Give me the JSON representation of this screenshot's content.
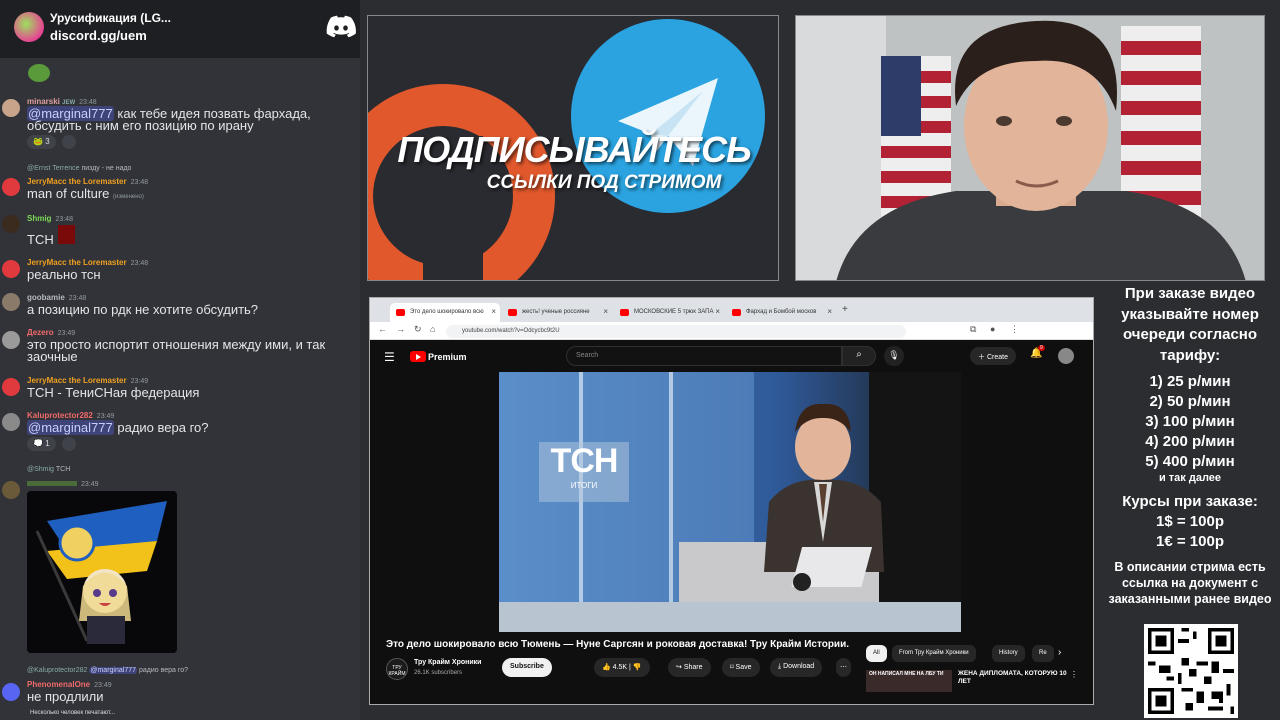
{
  "discord": {
    "server_name": "Урусификация (LG...",
    "invite": "discord.gg/uem",
    "messages": [
      {
        "user": "minarski",
        "badge": "JEW",
        "time": "23:48",
        "mention": "@marginal777",
        "text": " как тебе идея позвать фархада, обсудить с ним его позицию по ирану",
        "reaction_count": "3",
        "user_color": "#e0a0a0"
      },
      {
        "reply_to": "@Ernst Terrence",
        "reply_text": "пизду - не надо",
        "user": "JerryMacc the Loremaster",
        "time": "23:48",
        "text": "man of culture",
        "edited": "(изменено)",
        "user_color": "#f0a020"
      },
      {
        "user": "Shmig",
        "time": "23:48",
        "text": "ТСН",
        "user_color": "#7ed957"
      },
      {
        "user": "JerryMacc the Loremaster",
        "time": "23:48",
        "text": "реально тсн",
        "user_color": "#f0a020"
      },
      {
        "user": "goobamie",
        "time": "23:48",
        "text": "а позицию по рдк не хотите обсудить?",
        "user_color": "#b5bac1"
      },
      {
        "user": "Дezero",
        "time": "23:49",
        "text": "это просто испортит отношения между ими, и так заочные",
        "user_color": "#f06a6a"
      },
      {
        "user": "JerryMacc the Loremaster",
        "time": "23:49",
        "text": "ТСН - ТениСНая федерация",
        "user_color": "#f0a020"
      },
      {
        "user": "Kaluprotector282",
        "time": "23:49",
        "mention": "@marginal777",
        "text": " радио вера го?",
        "reaction_count": "1",
        "user_color": "#f06a6a"
      },
      {
        "reply_to": "@Shmig",
        "reply_text": "ТСН",
        "user": "",
        "time": "23:49",
        "text": "",
        "user_color": "#7ed957"
      },
      {
        "reply_to": "@Kaluprotector282",
        "reply_mention": "@marginal777",
        "reply_text": "радио вера го?",
        "user": "PhenomenalOne",
        "time": "23:49",
        "text": "не продлили",
        "user_color": "#f06a6a"
      }
    ],
    "typing": "Несколько человек печатают..."
  },
  "banner": {
    "title": "ПОДПИСЫВАЙТЕСЬ",
    "subtitle": "ССЫЛКИ ПОД СТРИМОМ"
  },
  "browser": {
    "tabs": [
      {
        "label": "Это дело шокировало всю"
      },
      {
        "label": "жесть! ученые россияне"
      },
      {
        "label": "МОСКОВСКИЕ 5 трюк ЗАПА"
      },
      {
        "label": "Фархад и Бомбой москов"
      }
    ],
    "new_tab": "+",
    "url": "youtube.com/watch?v=Odcycbc9t2U"
  },
  "youtube": {
    "premium_label": "Premium",
    "search_placeholder": "Search",
    "create_label": "Create",
    "notification_count": "9",
    "video_title": "Это дело шокировало всю Тюмень — Нуне Саргсян и роковая доставка! Тру Крайм Истории.",
    "channel_name": "Тру Крайм Хроники",
    "channel_avatar_text": "ТРУ КРАЙМ",
    "subscribers": "26.1K subscribers",
    "subscribe_label": "Subscribe",
    "likes": "4.5K",
    "share_label": "Share",
    "save_label": "Save",
    "download_label": "Download",
    "chips": [
      "All",
      "From Тру Крайм Хроники",
      "History",
      "Re"
    ],
    "rec_thumb_text": "ОН НАПИСАЛ МНЕ НА ЛБУ ТИ",
    "rec_title": "ЖЕНА ДИПЛОМАТА, КОТОРУЮ 10 ЛЕТ",
    "video_overlay": {
      "logo": "ТСН",
      "sub": "ИТОГИ"
    }
  },
  "pricing": {
    "intro": "При заказе видео указывайте номер очереди согласно тарифу:",
    "tiers": [
      "1) 25 р/мин",
      "2) 50 р/мин",
      "3) 100 р/мин",
      "4) 200 р/мин",
      "5) 400 р/мин"
    ],
    "etc": "и так далее",
    "rates_title": "Курсы при заказе:",
    "rates": [
      "1$ = 100р",
      "1€ = 100р"
    ],
    "description": "В описании стрима есть ссылка на документ с заказанными ранее видео"
  },
  "colors": {
    "discord_bg": "#313338",
    "youtube_red": "#ff0000",
    "telegram_blue": "#2aa3e0",
    "boosty_orange": "#e0582c"
  }
}
